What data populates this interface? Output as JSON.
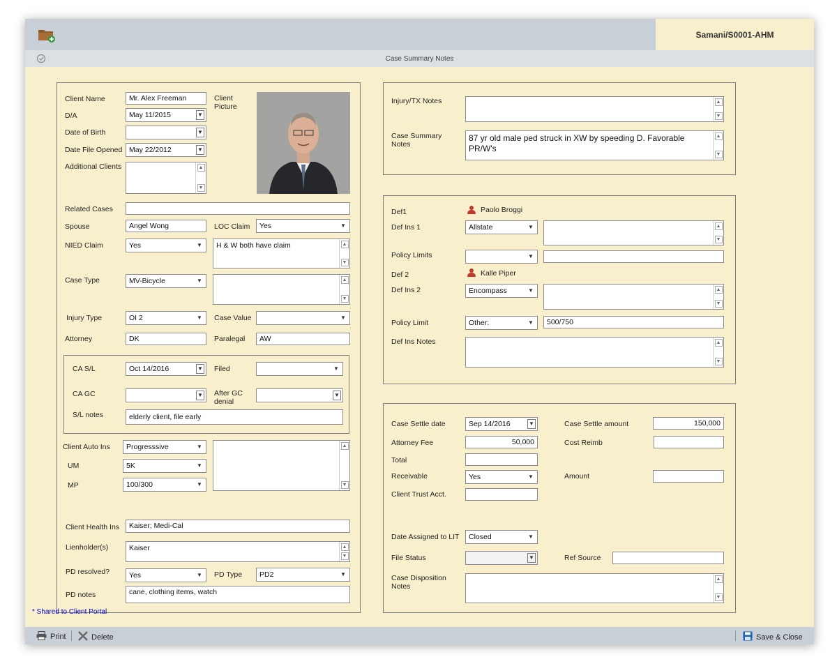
{
  "header": {
    "case_id": "Samani/S0001-AHM",
    "subtitle": "Case Summary Notes"
  },
  "icons": {
    "folder": "folder-add-icon",
    "check": "check-circle-icon",
    "print": "printer-icon",
    "delete": "x-icon",
    "save": "floppy-disk-icon",
    "person": "person-icon"
  },
  "colors": {
    "window_bg": "#f8f0cc",
    "toolbar": "#c9cfd6",
    "person_icon": "#c0392b",
    "shared_text": "#0000cc"
  },
  "left": {
    "client_name": {
      "label": "Client Name",
      "value": "Mr. Alex Freeman"
    },
    "da": {
      "label": "D/A",
      "value": "May 11/2015"
    },
    "dob": {
      "label": "Date of Birth",
      "value": ""
    },
    "date_file_opened": {
      "label": "Date File Opened",
      "value": "May 22/2012"
    },
    "additional_clients": {
      "label": "Additional Clients",
      "value": ""
    },
    "client_picture_label": "Client Picture",
    "related_cases": {
      "label": "Related Cases",
      "value": ""
    },
    "spouse": {
      "label": "Spouse",
      "value": "Angel Wong"
    },
    "loc_claim": {
      "label": "LOC Claim",
      "value": "Yes"
    },
    "nied_claim": {
      "label": "NIED Claim",
      "value": "Yes",
      "notes": "H & W both have claim"
    },
    "case_type": {
      "label": "Case Type",
      "value": "MV-Bicycle",
      "notes": ""
    },
    "injury_type": {
      "label": "Injury Type",
      "value": "OI 2"
    },
    "case_value": {
      "label": "Case Value",
      "value": ""
    },
    "attorney": {
      "label": "Attorney",
      "value": "DK"
    },
    "paralegal": {
      "label": "Paralegal",
      "value": "AW"
    },
    "ca_sl": {
      "label": "CA S/L",
      "value": "Oct 14/2016"
    },
    "filed": {
      "label": "Filed",
      "value": ""
    },
    "ca_gc": {
      "label": "CA GC",
      "value": ""
    },
    "after_gc_denial": {
      "label": "After GC denial",
      "value": ""
    },
    "sl_notes": {
      "label": "S/L notes",
      "value": "elderly client, file early"
    },
    "client_auto_ins": {
      "label": "Client Auto Ins",
      "value": "Progresssive",
      "notes": ""
    },
    "um": {
      "label": "UM",
      "value": "5K"
    },
    "mp": {
      "label": "MP",
      "value": "100/300"
    },
    "client_health_ins": {
      "label": "Client Health Ins",
      "value": "Kaiser; Medi-Cal"
    },
    "lienholders": {
      "label": "Lienholder(s)",
      "value": "Kaiser"
    },
    "pd_resolved": {
      "label": "PD resolved?",
      "value": "Yes"
    },
    "pd_type": {
      "label": "PD Type",
      "value": "PD2"
    },
    "pd_notes": {
      "label": "PD notes",
      "value": "cane, clothing items, watch"
    },
    "shared_note": "* Shared to Client Portal"
  },
  "right_top": {
    "injury_tx_notes": {
      "label": "Injury/TX Notes",
      "value": ""
    },
    "case_summary_notes": {
      "label": "Case Summary Notes",
      "value": "87 yr old male ped struck in XW by speeding D. Favorable PR/W's"
    }
  },
  "right_mid": {
    "def1": {
      "label": "Def1",
      "name": "Paolo Broggi"
    },
    "def_ins_1": {
      "label": "Def Ins 1",
      "value": "Allstate",
      "notes": ""
    },
    "policy_limits": {
      "label": "Policy Limits",
      "value": "",
      "extra": ""
    },
    "def2": {
      "label": "Def 2",
      "name": "Kalle Piper"
    },
    "def_ins_2": {
      "label": "Def Ins 2",
      "value": "Encompass",
      "notes": ""
    },
    "policy_limit": {
      "label": "Policy Limit",
      "value": "Other:",
      "extra": "500/750"
    },
    "def_ins_notes": {
      "label": "Def Ins Notes",
      "value": ""
    }
  },
  "right_bottom": {
    "case_settle_date": {
      "label": "Case Settle date",
      "value": "Sep 14/2016"
    },
    "case_settle_amount": {
      "label": "Case Settle amount",
      "value": "150,000"
    },
    "attorney_fee": {
      "label": "Attorney Fee",
      "value": "50,000"
    },
    "cost_reimb": {
      "label": "Cost Reimb",
      "value": ""
    },
    "total": {
      "label": "Total",
      "value": ""
    },
    "receivable": {
      "label": "Receivable",
      "value": "Yes"
    },
    "amount": {
      "label": "Amount",
      "value": ""
    },
    "client_trust_acct": {
      "label": "Client Trust Acct.",
      "value": ""
    },
    "date_assigned_lit": {
      "label": "Date Assigned to LIT",
      "value": "Closed"
    },
    "file_status": {
      "label": "File Status",
      "value": ""
    },
    "ref_source": {
      "label": "Ref Source",
      "value": ""
    },
    "case_disposition_notes": {
      "label": "Case Disposition Notes",
      "value": ""
    }
  },
  "footer": {
    "print": "Print",
    "delete": "Delete",
    "save_close": "Save & Close"
  }
}
